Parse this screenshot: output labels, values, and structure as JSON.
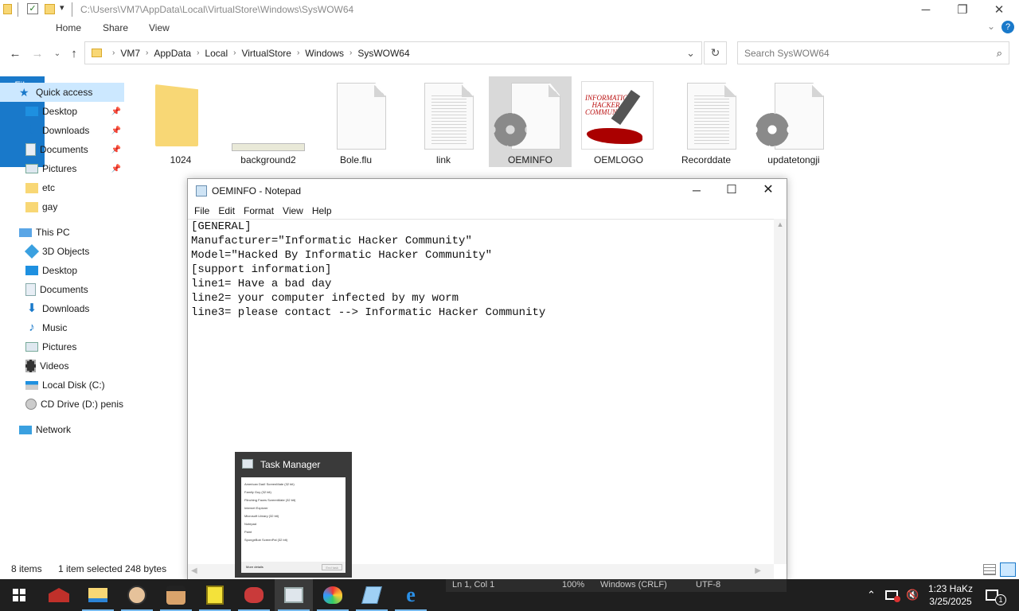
{
  "window": {
    "path_title": "C:\\Users\\VM7\\AppData\\Local\\VirtualStore\\Windows\\SysWOW64"
  },
  "ribbon": {
    "tabs": [
      "File",
      "Home",
      "Share",
      "View"
    ]
  },
  "address": {
    "crumbs": [
      "VM7",
      "AppData",
      "Local",
      "VirtualStore",
      "Windows",
      "SysWOW64"
    ],
    "search_placeholder": "Search SysWOW64"
  },
  "sidebar": {
    "quick_access": "Quick access",
    "pinned": [
      "Desktop",
      "Downloads",
      "Documents",
      "Pictures"
    ],
    "folders": [
      "etc",
      "gay"
    ],
    "this_pc": "This PC",
    "pc_items": [
      "3D Objects",
      "Desktop",
      "Documents",
      "Downloads",
      "Music",
      "Pictures",
      "Videos",
      "Local Disk (C:)",
      "CD Drive (D:) penis"
    ],
    "network": "Network"
  },
  "files": [
    {
      "name": "1024",
      "kind": "folder"
    },
    {
      "name": "background2",
      "kind": "image"
    },
    {
      "name": "Bole.flu",
      "kind": "blank"
    },
    {
      "name": "link",
      "kind": "text"
    },
    {
      "name": "OEMINFO",
      "kind": "settings",
      "selected": true
    },
    {
      "name": "OEMLOGO",
      "kind": "logo"
    },
    {
      "name": "Recorddate",
      "kind": "text"
    },
    {
      "name": "updatetongji",
      "kind": "settings"
    }
  ],
  "oemlogo_text": "INFORMATIC HACKER COMMUNITY",
  "notepad": {
    "title": "OEMINFO - Notepad",
    "menu": [
      "File",
      "Edit",
      "Format",
      "View",
      "Help"
    ],
    "content": "[GENERAL]\nManufacturer=\"Informatic Hacker Community\"\nModel=\"Hacked By Informatic Hacker Community\"\n[support information]\nline1= Have a bad day\nline2= your computer infected by my worm\nline3= please contact --> Informatic Hacker Community",
    "status": {
      "position": "Ln 1, Col 1",
      "zoom": "100%",
      "line_ending": "Windows (CRLF)",
      "encoding": "UTF-8"
    }
  },
  "status": {
    "items": "8 items",
    "selected": "1 item selected  248 bytes"
  },
  "preview": {
    "title": "Task Manager",
    "rows": [
      "American Dad! ScreenMate (32 bit)",
      "Family Guy (32 bit)",
      "Flinching Faces ScreenMate (32 bit)",
      "Internet Explorer",
      "Microsoft Library (32 bit)",
      "Notepad",
      "Paint",
      "SpongeBob ScreenPal (32 bit)"
    ],
    "footer_left": "More details",
    "footer_right": "End task"
  },
  "tray": {
    "time": "1:23 HaKz",
    "date": "3/25/2025",
    "notifications": "1"
  },
  "colors": {
    "accent": "#1979ca",
    "selection": "#cce8ff",
    "taskbar": "#1f1f1f",
    "folder": "#f8d775"
  }
}
